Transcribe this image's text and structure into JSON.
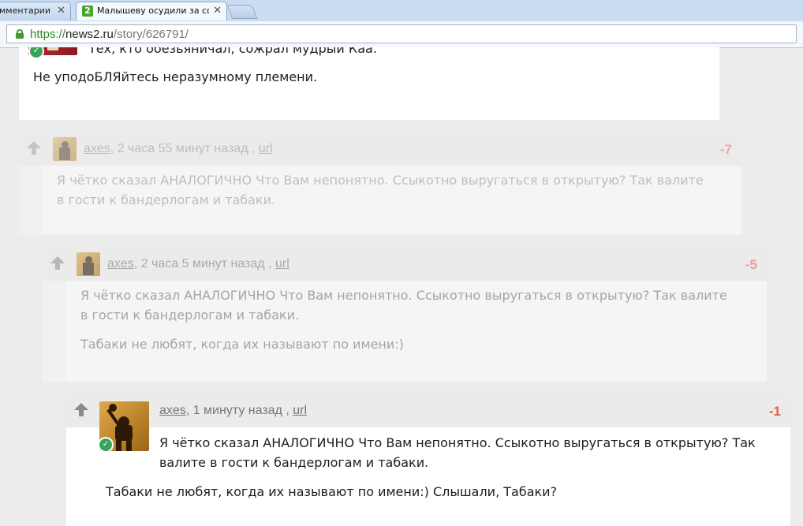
{
  "browser": {
    "tabs": [
      {
        "title": "мментарии / ",
        "active": false
      },
      {
        "title": "Малышеву осудили за сов",
        "active": true
      }
    ],
    "tab_close": "✕",
    "favicon_text": "2",
    "url": {
      "scheme": "https://",
      "host": "news2.ru",
      "path": "/story/626791/"
    }
  },
  "comments": [
    {
      "id": "c0",
      "lines": [
        "Тех, кто обезьяничал, сожрал мудрый Каа.",
        "Не уподоБЛЯйтесь неразумному племени."
      ]
    },
    {
      "id": "c1",
      "author": "axes",
      "time": ", 2 часа 55 минут назад , ",
      "link": "url",
      "score": "-7",
      "paragraphs": [
        "Я чётко сказал АНАЛОГИЧНО Что Вам непонятно. Ссыкотно выругаться в открытую? Так валите\nв гости к бандерлогам и табаки."
      ]
    },
    {
      "id": "c2",
      "author": "axes",
      "time": ", 2 часа 5 минут назад , ",
      "link": "url",
      "score": "-5",
      "paragraphs": [
        "Я чётко сказал АНАЛОГИЧНО Что Вам непонятно. Ссыкотно выругаться в открытую? Так валите\nв гости к бандерлогам и табаки.",
        "Табаки не любят, когда их называют по имени:)"
      ]
    },
    {
      "id": "c3",
      "author": "axes",
      "time": ", 1 минуту назад , ",
      "link": "url",
      "score": "-1",
      "paragraphs": [
        "Я чётко сказал АНАЛОГИЧНО Что Вам непонятно. Ссыкотно выругаться в открытую? Так\nвалите в гости к бандерлогам и табаки.",
        "Табаки не любят, когда их называют по имени:) Слышали, Табаки?"
      ]
    }
  ],
  "colors": {
    "score_faded": "#f0a7a0",
    "score_strong": "#e25b4a",
    "verified": "#3aa35a",
    "link_green": "#2e8b2e"
  },
  "icons": {
    "upvote": "arrow-up-icon",
    "verified": "check-circle-icon",
    "secure": "lock-icon"
  }
}
